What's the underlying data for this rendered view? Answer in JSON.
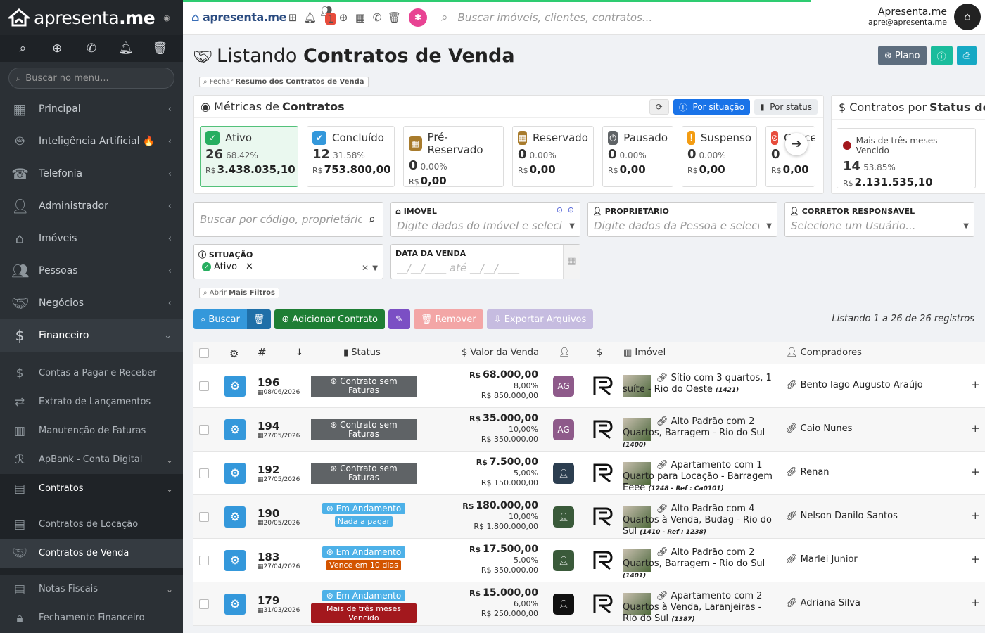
{
  "sidebar": {
    "brand_a": "apresenta",
    "brand_b": ".me",
    "search_placeholder": "Buscar no menu...",
    "menu": [
      {
        "label": "Principal",
        "icon": "grid-icon"
      },
      {
        "label": "Inteligência Artificial 🔥",
        "icon": "robot-icon"
      },
      {
        "label": "Telefonia",
        "icon": "phone-icon"
      },
      {
        "label": "Administrador",
        "icon": "user-admin-icon"
      },
      {
        "label": "Imóveis",
        "icon": "home-icon"
      },
      {
        "label": "Pessoas",
        "icon": "people-icon"
      },
      {
        "label": "Negócios",
        "icon": "handshake-icon"
      },
      {
        "label": "Financeiro",
        "icon": "dollar-circle-icon"
      }
    ],
    "sub": [
      {
        "label": "Contas a Pagar e Receber",
        "icon": "dollar-icon"
      },
      {
        "label": "Extrato de Lançamentos",
        "icon": "shuffle-icon"
      },
      {
        "label": "Manutenção de Faturas",
        "icon": "barcode-icon"
      },
      {
        "label": "ApBank - Conta Digital",
        "icon": "apbank-icon"
      },
      {
        "label": "Contratos",
        "icon": "contract-icon"
      },
      {
        "label": "Contratos de Locação",
        "icon": "contract-icon"
      },
      {
        "label": "Contratos de Venda",
        "icon": "handshake-icon"
      },
      {
        "label": "Notas Fiscais",
        "icon": "invoice-icon"
      },
      {
        "label": "Fechamento Financeiro",
        "icon": "lock-icon"
      }
    ]
  },
  "topbar": {
    "brand_a": "apresenta",
    "brand_b": ".me",
    "notification_badge": "1",
    "search_placeholder": "Buscar imóveis, clientes, contratos...",
    "user_name": "Apresenta.me",
    "user_email": "apre@apresenta.me"
  },
  "page": {
    "title_a": "Listando ",
    "title_b": "Contratos de Venda",
    "btn_plano": "Plano",
    "toggle_resumo_a": "Fechar ",
    "toggle_resumo_b": "Resumo dos Contratos de Venda",
    "toggle_filtros_a": "Abrir ",
    "toggle_filtros_b": "Mais Filtros"
  },
  "metrics": {
    "title_a": "Métricas de ",
    "title_b": "Contratos",
    "btn_situacao": "Por situação",
    "btn_status": "Por status",
    "cards": [
      {
        "label": "Ativo",
        "count": "26",
        "pct": "68.42%",
        "cur": "R$",
        "amount": "3.438.035,10",
        "color": "#27ae60",
        "icon": "✓"
      },
      {
        "label": "Concluído",
        "count": "12",
        "pct": "31.58%",
        "cur": "R$",
        "amount": "753.800,00",
        "color": "#3498db",
        "icon": "✔"
      },
      {
        "label": "Pré-Reservado",
        "count": "0",
        "pct": "0.00%",
        "cur": "R$",
        "amount": "0,00",
        "color": "#a87b2c",
        "icon": "▦"
      },
      {
        "label": "Reservado",
        "count": "0",
        "pct": "0.00%",
        "cur": "R$",
        "amount": "0,00",
        "color": "#a87b2c",
        "icon": "▦"
      },
      {
        "label": "Pausado",
        "count": "0",
        "pct": "0.00%",
        "cur": "R$",
        "amount": "0,00",
        "color": "#5f6366",
        "icon": "⏻"
      },
      {
        "label": "Suspenso",
        "count": "0",
        "pct": "0.00%",
        "cur": "R$",
        "amount": "0,00",
        "color": "#f39c12",
        "icon": "!"
      },
      {
        "label": "Cance",
        "count": "0",
        "pct": "",
        "cur": "R$",
        "amount": "0,00",
        "color": "#e74c3c",
        "icon": "⊘"
      }
    ]
  },
  "status_panel": {
    "title_a": "Contratos por ",
    "title_b": "Status de",
    "label": "Mais de três meses Vencido",
    "count": "14",
    "pct": "53.85%",
    "cur": "R$",
    "amount": "2.131.535,10"
  },
  "filters": {
    "search_placeholder": "Buscar por código, proprietário",
    "imovel_label": "IMÓVEL",
    "imovel_placeholder": "Digite dados do Imóvel e selecione",
    "proprietario_label": "PROPRIETÁRIO",
    "proprietario_placeholder": "Digite dados da Pessoa e selecione",
    "corretor_label": "CORRETOR RESPONSÁVEL",
    "corretor_placeholder": "Selecione um Usuário...",
    "situacao_label": "SITUAÇÃO",
    "situacao_value": "Ativo",
    "data_label": "DATA DA VENDA",
    "data_placeholder": "__/__/____  até  __/__/____"
  },
  "actions": {
    "buscar": "Buscar",
    "adicionar": "Adicionar Contrato",
    "remover": "Remover",
    "exportar": "Exportar Arquivos",
    "listing": "Listando 1 a 26 de 26 registros"
  },
  "table": {
    "headers": {
      "hash": "#",
      "status": "Status",
      "valor": "Valor da Venda",
      "imovel": "Imóvel",
      "compradores": "Compradores"
    },
    "rows": [
      {
        "num": "196",
        "date": "08/06/2026",
        "status": "Contrato sem Faturas",
        "status_type": "gray",
        "sub": "",
        "sub_color": "",
        "value": "68.000,00",
        "pct": "8,00%",
        "total": "R$ 850.000,00",
        "av": "AG",
        "av_color": "#8e5a8a",
        "imovel": "Sítio com 3 quartos, 1 suíte - Rio do Oeste",
        "ref": "(1421)",
        "buyer": "Bento Iago Augusto Araújo"
      },
      {
        "num": "194",
        "date": "27/05/2026",
        "status": "Contrato sem Faturas",
        "status_type": "gray",
        "sub": "",
        "sub_color": "",
        "value": "35.000,00",
        "pct": "10,00%",
        "total": "R$ 350.000,00",
        "av": "AG",
        "av_color": "#8e5a8a",
        "imovel": "Alto Padrão com 2 Quartos, Barragem - Rio do Sul",
        "ref": "(1400)",
        "buyer": "Caio Nunes"
      },
      {
        "num": "192",
        "date": "27/05/2026",
        "status": "Contrato sem Faturas",
        "status_type": "gray",
        "sub": "",
        "sub_color": "",
        "value": "7.500,00",
        "pct": "5,00%",
        "total": "R$ 150.000,00",
        "av": "",
        "av_color": "#2c3e50",
        "imovel": "Apartamento com 1 Quarto para Locação - Barragem Eeee",
        "ref": "(1248 - Ref : Ca0101)",
        "buyer": "Renan"
      },
      {
        "num": "190",
        "date": "20/05/2026",
        "status": "Em Andamento",
        "status_type": "blue",
        "sub": "Nada a pagar",
        "sub_color": "#4db1e8",
        "value": "180.000,00",
        "pct": "10,00%",
        "total": "R$ 1.800.000,00",
        "av": "",
        "av_color": "#3a5a3a",
        "imovel": "Alto Padrão com 4 Quartos à Venda, Budag - Rio do Sul",
        "ref": "(1410 - Ref : 1238)",
        "buyer": "Nelson Danilo Santos"
      },
      {
        "num": "183",
        "date": "27/04/2026",
        "status": "Em Andamento",
        "status_type": "blue",
        "sub": "Vence em 10 dias",
        "sub_color": "#d35400",
        "value": "17.500,00",
        "pct": "5,00%",
        "total": "R$ 350.000,00",
        "av": "",
        "av_color": "#3a5a3a",
        "imovel": "Alto Padrão com 2 Quartos, Barragem - Rio do Sul",
        "ref": "(1401)",
        "buyer": "Marlei Junior"
      },
      {
        "num": "179",
        "date": "31/03/2026",
        "status": "Em Andamento",
        "status_type": "blue",
        "sub": "Mais de três meses Vencido",
        "sub_color": "#a3181d",
        "value": "15.000,00",
        "pct": "6,00%",
        "total": "R$ 250.000,00",
        "av": "",
        "av_color": "#111",
        "imovel": "Apartamento com 2 Quartos à Venda, Laranjeiras - Rio do Sul",
        "ref": "(1387)",
        "buyer": "Adriana Silva"
      }
    ]
  }
}
